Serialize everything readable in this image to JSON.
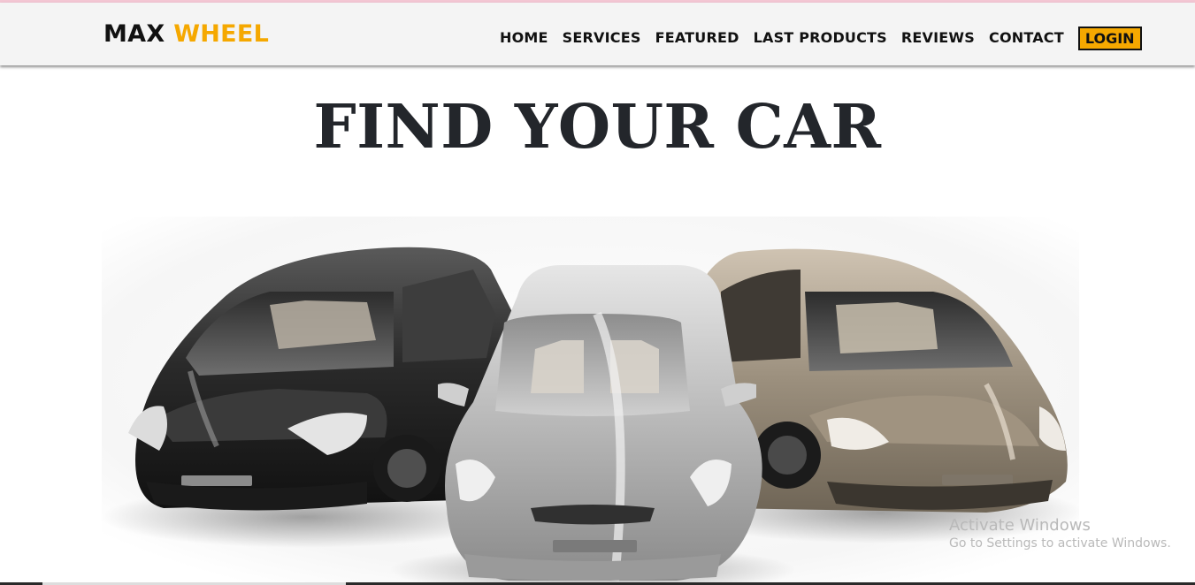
{
  "brand": {
    "first": "MAX",
    "second": "WHEEL",
    "accent_color": "#f5a800"
  },
  "nav": {
    "items": [
      "HOME",
      "SERVICES",
      "FEATURED",
      "LAST PRODUCTS",
      "REVIEWS",
      "CONTACT"
    ],
    "login_label": "LOGIN"
  },
  "hero": {
    "title": "FIND YOUR CAR",
    "image_icon": "three-cars-photo"
  },
  "watermark": {
    "title": "Activate Windows",
    "subtitle": "Go to Settings to activate Windows."
  }
}
